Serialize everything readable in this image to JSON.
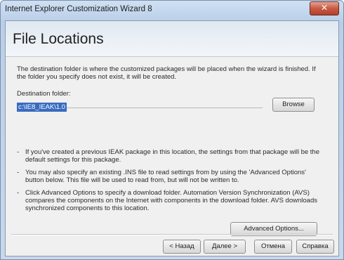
{
  "window": {
    "title": "Internet Explorer Customization Wizard 8",
    "close_glyph": "✕"
  },
  "page": {
    "title": "File Locations",
    "description": "The destination folder is where the customized packages will be placed when the wizard is finished. If the folder you specify does not exist, it will be created."
  },
  "destination": {
    "label": "Destination folder:",
    "value": "c:\\IE8_IEAK\\1.0",
    "browse_label": "Browse"
  },
  "bullets": [
    "If you've created a previous IEAK package in this location, the settings from that package will be the default settings for this package.",
    "You may also specify an existing .INS file to read settings from by using the 'Advanced Options' button below. This file will be used to read from, but will not be written to.",
    "Click Advanced Options to specify a download folder. Automation Version Synchronization (AVS) compares the components on the Internet with components in the download folder. AVS downloads synchronized components to this location."
  ],
  "advanced_options_label": "Advanced Options...",
  "nav": {
    "back_label": "< Назад",
    "next_label": "Далее >",
    "cancel_label": "Отмена",
    "help_label": "Справка"
  }
}
